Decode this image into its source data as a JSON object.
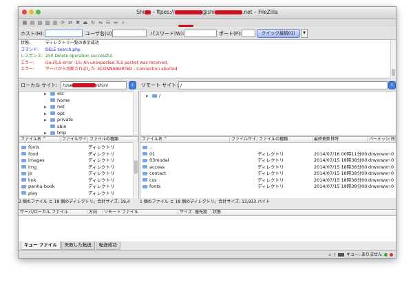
{
  "window": {
    "title_pre": "Shi",
    "title_mid": " – ftpes://",
    "title_at": "@shi",
    "title_post": ".net – FileZilla"
  },
  "toolbar": {
    "icons": [
      "site-manager-icon",
      "toggle-log-icon",
      "toggle-local-tree-icon",
      "toggle-remote-tree-icon",
      "toggle-queue-icon",
      "refresh-icon",
      "process-queue-icon",
      "cancel-icon",
      "disconnect-icon",
      "reconnect-icon",
      "compare-icon",
      "filter-icon",
      "sync-browse-icon",
      "search-icon"
    ]
  },
  "quickconnect": {
    "host_label": "ホスト(H):",
    "user_label": "ユーザ名(U):",
    "pass_label": "パスワード(W):",
    "port_label": "ポート(P):",
    "host_value": "",
    "user_value": "",
    "pass_value": "",
    "port_value": "",
    "connect_label": "クイック接続(Q)"
  },
  "log": [
    {
      "type": "状態:",
      "msg": "ディレクトリ一覧の表示成功",
      "color": "#111111"
    },
    {
      "type": "コマンド:",
      "msg": "DELE search.php",
      "color": "#0b2fcc"
    },
    {
      "type": "レスポンス:",
      "msg": "250 Delete operation successful.",
      "color": "#1a8a1a"
    },
    {
      "type": "エラー:",
      "msg": "GnuTLS error -15: An unexpected TLS packet was received.",
      "color": "#d41414"
    },
    {
      "type": "エラー:",
      "msg": "サーバから切断されました: ECONNABORTED - Connection aborted",
      "color": "#d41414"
    }
  ],
  "local": {
    "site_label": "ローカル サイト:",
    "path_pre": "/Use",
    "path_post": "/shin/",
    "tree": [
      "etc",
      "home",
      "net",
      "opt",
      "private",
      "sbin",
      "tmp"
    ],
    "headers": [
      "ファイル名 ^",
      "ファイルサイズ",
      "ファイルの種類"
    ],
    "files": [
      {
        "name": "fonts",
        "type": "ディレクトリ"
      },
      {
        "name": "food",
        "type": "ディレクトリ"
      },
      {
        "name": "images",
        "type": "ディレクトリ"
      },
      {
        "name": "img",
        "type": "ディレクトリ"
      },
      {
        "name": "js",
        "type": "ディレクトリ"
      },
      {
        "name": "link",
        "type": "ディレクトリ"
      },
      {
        "name": "panhu-book",
        "type": "ディレクトリ"
      },
      {
        "name": "play",
        "type": "ディレクトリ"
      }
    ],
    "status": "3 個のファイル と 18 個のディレクトリ。合計サイズ: 19,4"
  },
  "remote": {
    "site_label": "リモート サイト:",
    "path": "/",
    "tree_root": "/",
    "headers": [
      "ファイル名 ^",
      "ファイルサイズ",
      "ファイルの種類",
      "最終更新日時",
      "パーミッション",
      "所有"
    ],
    "files": [
      {
        "name": "..",
        "type": "",
        "date": "",
        "perm": ""
      },
      {
        "name": "01",
        "type": "ディレクトリ",
        "date": "2014/07/16 00時11分00秒",
        "perm": "drwxrwxrwx",
        "own": "0"
      },
      {
        "name": "03modal",
        "type": "ディレクトリ",
        "date": "2014/07/15 18時38分00秒",
        "perm": "drwxrwxrwx",
        "own": "0"
      },
      {
        "name": "access",
        "type": "ディレクトリ",
        "date": "2014/07/15 18時38分00秒",
        "perm": "drwxrwxrwx",
        "own": "0"
      },
      {
        "name": "contact",
        "type": "ディレクトリ",
        "date": "2014/07/15 18時38分00秒",
        "perm": "drwxrwxrwx",
        "own": "0"
      },
      {
        "name": "css",
        "type": "ディレクトリ",
        "date": "2014/07/15 18時38分00秒",
        "perm": "drwxrwxrwx",
        "own": "0"
      },
      {
        "name": "fonts",
        "type": "ディレクトリ",
        "date": "2014/07/15 18時38分00秒",
        "perm": "drwxrwxrwx",
        "own": "0"
      }
    ],
    "status": "1 個のファイル と 18 個のディレクトリ。合計サイズ: 13,933 バイト"
  },
  "queue": {
    "headers": [
      "サーバ/ローカル ファイル",
      "方向",
      "リモート ファイル",
      "サイズ",
      "優先度",
      "状態"
    ],
    "tabs": [
      "キュー ファイル",
      "失敗した転送",
      "転送成功"
    ]
  },
  "statusbar": {
    "queue_text": "キュー: ありません"
  }
}
